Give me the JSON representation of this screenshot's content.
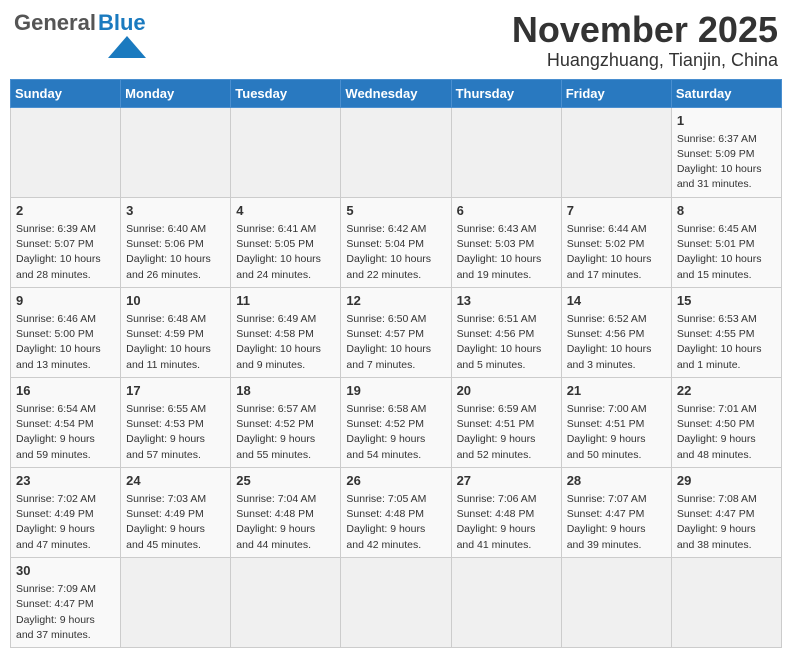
{
  "header": {
    "logo_general": "General",
    "logo_blue": "Blue",
    "month_title": "November 2025",
    "location": "Huangzhuang, Tianjin, China"
  },
  "weekdays": [
    "Sunday",
    "Monday",
    "Tuesday",
    "Wednesday",
    "Thursday",
    "Friday",
    "Saturday"
  ],
  "weeks": [
    [
      {
        "day": "",
        "info": ""
      },
      {
        "day": "",
        "info": ""
      },
      {
        "day": "",
        "info": ""
      },
      {
        "day": "",
        "info": ""
      },
      {
        "day": "",
        "info": ""
      },
      {
        "day": "",
        "info": ""
      },
      {
        "day": "1",
        "info": "Sunrise: 6:37 AM\nSunset: 5:09 PM\nDaylight: 10 hours\nand 31 minutes."
      }
    ],
    [
      {
        "day": "2",
        "info": "Sunrise: 6:39 AM\nSunset: 5:07 PM\nDaylight: 10 hours\nand 28 minutes."
      },
      {
        "day": "3",
        "info": "Sunrise: 6:40 AM\nSunset: 5:06 PM\nDaylight: 10 hours\nand 26 minutes."
      },
      {
        "day": "4",
        "info": "Sunrise: 6:41 AM\nSunset: 5:05 PM\nDaylight: 10 hours\nand 24 minutes."
      },
      {
        "day": "5",
        "info": "Sunrise: 6:42 AM\nSunset: 5:04 PM\nDaylight: 10 hours\nand 22 minutes."
      },
      {
        "day": "6",
        "info": "Sunrise: 6:43 AM\nSunset: 5:03 PM\nDaylight: 10 hours\nand 19 minutes."
      },
      {
        "day": "7",
        "info": "Sunrise: 6:44 AM\nSunset: 5:02 PM\nDaylight: 10 hours\nand 17 minutes."
      },
      {
        "day": "8",
        "info": "Sunrise: 6:45 AM\nSunset: 5:01 PM\nDaylight: 10 hours\nand 15 minutes."
      }
    ],
    [
      {
        "day": "9",
        "info": "Sunrise: 6:46 AM\nSunset: 5:00 PM\nDaylight: 10 hours\nand 13 minutes."
      },
      {
        "day": "10",
        "info": "Sunrise: 6:48 AM\nSunset: 4:59 PM\nDaylight: 10 hours\nand 11 minutes."
      },
      {
        "day": "11",
        "info": "Sunrise: 6:49 AM\nSunset: 4:58 PM\nDaylight: 10 hours\nand 9 minutes."
      },
      {
        "day": "12",
        "info": "Sunrise: 6:50 AM\nSunset: 4:57 PM\nDaylight: 10 hours\nand 7 minutes."
      },
      {
        "day": "13",
        "info": "Sunrise: 6:51 AM\nSunset: 4:56 PM\nDaylight: 10 hours\nand 5 minutes."
      },
      {
        "day": "14",
        "info": "Sunrise: 6:52 AM\nSunset: 4:56 PM\nDaylight: 10 hours\nand 3 minutes."
      },
      {
        "day": "15",
        "info": "Sunrise: 6:53 AM\nSunset: 4:55 PM\nDaylight: 10 hours\nand 1 minute."
      }
    ],
    [
      {
        "day": "16",
        "info": "Sunrise: 6:54 AM\nSunset: 4:54 PM\nDaylight: 9 hours\nand 59 minutes."
      },
      {
        "day": "17",
        "info": "Sunrise: 6:55 AM\nSunset: 4:53 PM\nDaylight: 9 hours\nand 57 minutes."
      },
      {
        "day": "18",
        "info": "Sunrise: 6:57 AM\nSunset: 4:52 PM\nDaylight: 9 hours\nand 55 minutes."
      },
      {
        "day": "19",
        "info": "Sunrise: 6:58 AM\nSunset: 4:52 PM\nDaylight: 9 hours\nand 54 minutes."
      },
      {
        "day": "20",
        "info": "Sunrise: 6:59 AM\nSunset: 4:51 PM\nDaylight: 9 hours\nand 52 minutes."
      },
      {
        "day": "21",
        "info": "Sunrise: 7:00 AM\nSunset: 4:51 PM\nDaylight: 9 hours\nand 50 minutes."
      },
      {
        "day": "22",
        "info": "Sunrise: 7:01 AM\nSunset: 4:50 PM\nDaylight: 9 hours\nand 48 minutes."
      }
    ],
    [
      {
        "day": "23",
        "info": "Sunrise: 7:02 AM\nSunset: 4:49 PM\nDaylight: 9 hours\nand 47 minutes."
      },
      {
        "day": "24",
        "info": "Sunrise: 7:03 AM\nSunset: 4:49 PM\nDaylight: 9 hours\nand 45 minutes."
      },
      {
        "day": "25",
        "info": "Sunrise: 7:04 AM\nSunset: 4:48 PM\nDaylight: 9 hours\nand 44 minutes."
      },
      {
        "day": "26",
        "info": "Sunrise: 7:05 AM\nSunset: 4:48 PM\nDaylight: 9 hours\nand 42 minutes."
      },
      {
        "day": "27",
        "info": "Sunrise: 7:06 AM\nSunset: 4:48 PM\nDaylight: 9 hours\nand 41 minutes."
      },
      {
        "day": "28",
        "info": "Sunrise: 7:07 AM\nSunset: 4:47 PM\nDaylight: 9 hours\nand 39 minutes."
      },
      {
        "day": "29",
        "info": "Sunrise: 7:08 AM\nSunset: 4:47 PM\nDaylight: 9 hours\nand 38 minutes."
      }
    ],
    [
      {
        "day": "30",
        "info": "Sunrise: 7:09 AM\nSunset: 4:47 PM\nDaylight: 9 hours\nand 37 minutes."
      },
      {
        "day": "",
        "info": ""
      },
      {
        "day": "",
        "info": ""
      },
      {
        "day": "",
        "info": ""
      },
      {
        "day": "",
        "info": ""
      },
      {
        "day": "",
        "info": ""
      },
      {
        "day": "",
        "info": ""
      }
    ]
  ]
}
